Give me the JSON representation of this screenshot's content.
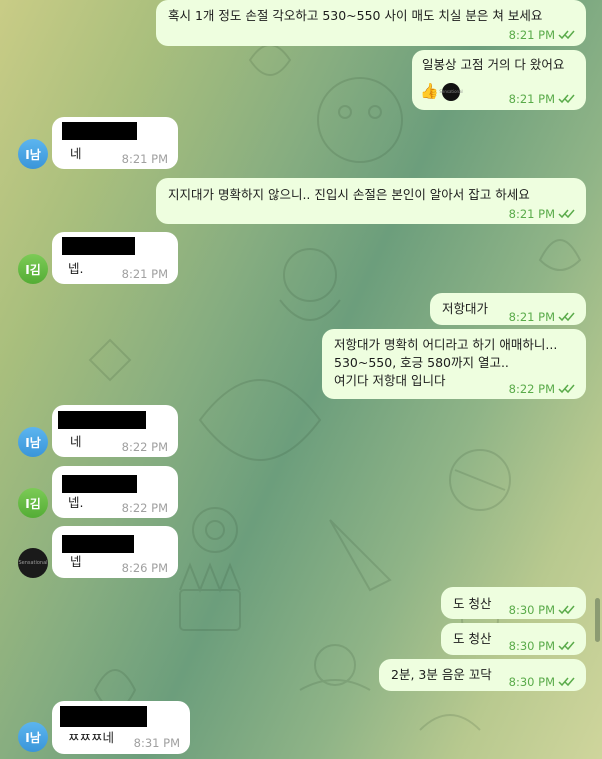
{
  "messages": [
    {
      "id": "m1",
      "dir": "out",
      "lines": [
        "혹시  1개 정도 손절 각오하고  530~550 사이 매도 치실 분은 쳐 보세요"
      ],
      "time": "8:21 PM"
    },
    {
      "id": "m2",
      "dir": "out",
      "lines": [
        "일봉상 고점 거의 다 왔어요"
      ],
      "time": "8:21 PM",
      "emoji": "👍",
      "avatar_text": "Sensational"
    },
    {
      "id": "m3",
      "dir": "in",
      "sender_initials": "I남",
      "lines": [
        "네"
      ],
      "time": "8:21 PM"
    },
    {
      "id": "m4",
      "dir": "out",
      "lines": [
        "지지대가 명확하지 않으니.. 진입시 손절은 본인이 알아서 잡고 하세요"
      ],
      "time": "8:21 PM"
    },
    {
      "id": "m5",
      "dir": "in",
      "sender_initials": "I김",
      "lines": [
        "넵."
      ],
      "time": "8:21 PM"
    },
    {
      "id": "m6",
      "dir": "out",
      "lines": [
        "저항대가"
      ],
      "time": "8:21 PM"
    },
    {
      "id": "m7",
      "dir": "out",
      "lines": [
        "저항대가 명확히 어디라고 하기 애매하니...",
        "530~550, 호긍 580까지 열고..",
        "여기다 저항대 입니다"
      ],
      "time": "8:22 PM"
    },
    {
      "id": "m8",
      "dir": "in",
      "sender_initials": "I남",
      "lines": [
        "네"
      ],
      "time": "8:22 PM"
    },
    {
      "id": "m9",
      "dir": "in",
      "sender_initials": "I김",
      "lines": [
        "넵."
      ],
      "time": "8:22 PM"
    },
    {
      "id": "m10",
      "dir": "in",
      "sender_initials": "Sensational",
      "lines": [
        "넵"
      ],
      "time": "8:26 PM"
    },
    {
      "id": "m11",
      "dir": "out",
      "lines": [
        "도 청산"
      ],
      "time": "8:30 PM"
    },
    {
      "id": "m12",
      "dir": "out",
      "lines": [
        "도 청산"
      ],
      "time": "8:30 PM"
    },
    {
      "id": "m13",
      "dir": "out",
      "lines": [
        "2분, 3분 음운 꼬닥"
      ],
      "time": "8:30 PM"
    },
    {
      "id": "m14",
      "dir": "in",
      "sender_initials": "I남",
      "lines": [
        "ㅉㅉㅉ네"
      ],
      "time": "8:31 PM"
    }
  ],
  "icons": {
    "read_receipt": "double-check-icon"
  },
  "colors": {
    "outgoing_bubble": "#eefedf",
    "incoming_bubble": "#ffffff",
    "read_check": "#5aab4a",
    "avatar_blue": "#3a95d9",
    "avatar_green": "#54ad35"
  }
}
